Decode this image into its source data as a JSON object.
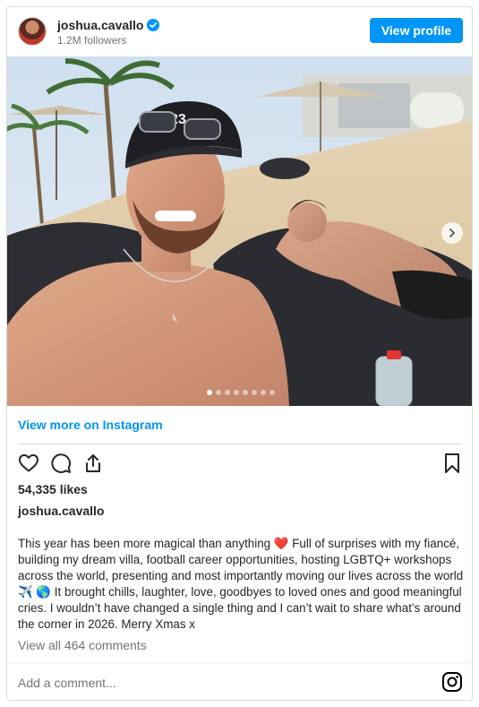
{
  "header": {
    "username": "joshua.cavallo",
    "followers": "1.2M followers",
    "view_profile_label": "View profile"
  },
  "photo": {
    "slide_count": 8,
    "active_slide": 0
  },
  "view_more_label": "View more on Instagram",
  "likes": "54,335 likes",
  "author": "joshua.cavallo",
  "caption": "This year has been more magical than anything ❤️ Full of surprises with my fiancé, building my dream villa, football career opportunities, hosting LGBTQ+ workshops across the world, presenting and most importantly moving our lives across the world ✈️ 🌎 It brought chills, laughter, love, goodbyes to loved ones and good meaningful cries. I wouldn’t have changed a single thing and I can’t wait to share what’s around the corner in 2026. Merry Xmas x",
  "view_all_comments": "View all 464 comments",
  "comment_placeholder": "Add a comment...",
  "colors": {
    "accent": "#0095f6",
    "text": "#262626",
    "muted": "#737373",
    "border": "#dbdbdb"
  },
  "icons": [
    "verified-badge-icon",
    "chevron-right-icon",
    "heart-icon",
    "comment-icon",
    "share-icon",
    "bookmark-icon",
    "instagram-icon"
  ]
}
